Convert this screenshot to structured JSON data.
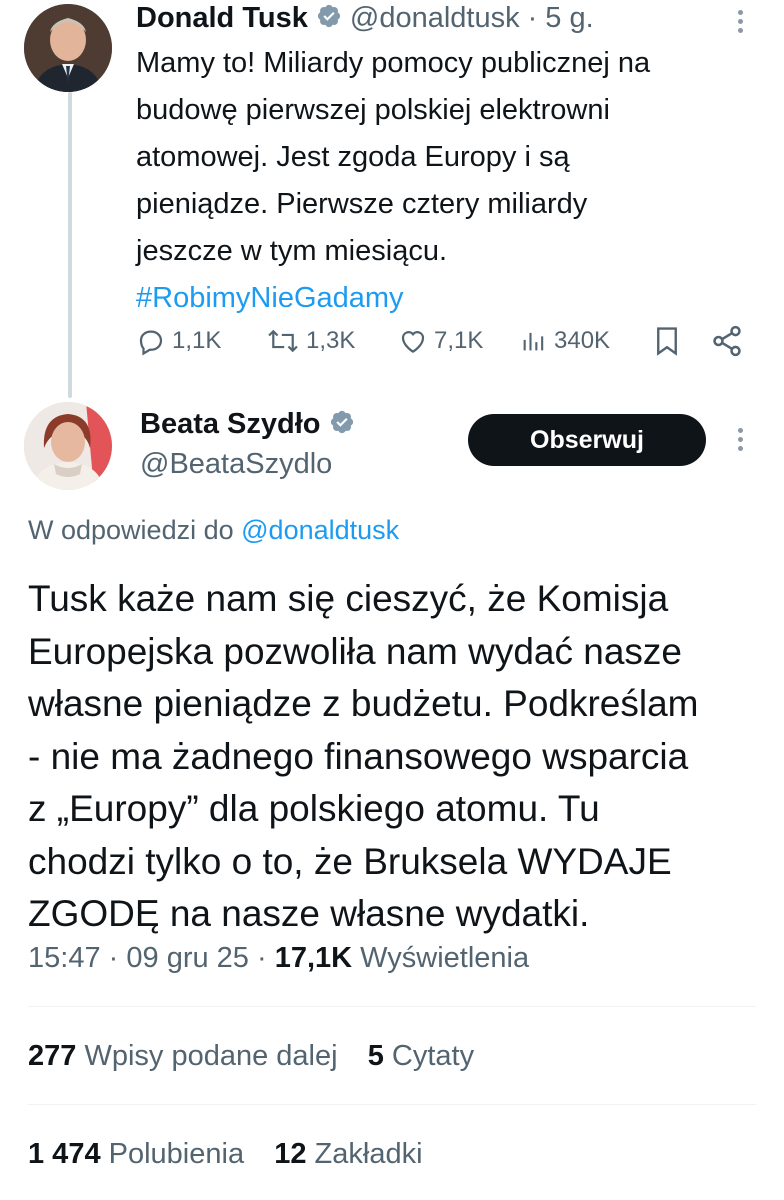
{
  "parent_tweet": {
    "author_name": "Donald Tusk",
    "handle": "@donaldtusk",
    "separator": "·",
    "time": "5 g.",
    "text_lines": [
      "Mamy to! Miliardy pomocy publicznej na",
      "budowę pierwszej polskiej elektrowni",
      "atomowej. Jest zgoda Europy i są",
      "pieniądze. Pierwsze cztery miliardy",
      "jeszcze w tym miesiącu."
    ],
    "hashtag": "#RobimyNieGadamy",
    "actions": {
      "replies": "1,1K",
      "retweets": "1,3K",
      "likes": "7,1K",
      "views": "340K"
    }
  },
  "reply_tweet": {
    "author_name": "Beata Szydło",
    "handle": "@BeataSzydlo",
    "follow_label": "Obserwuj",
    "replying_to_prefix": "W odpowiedzi do",
    "replying_to_handle": "@donaldtusk",
    "text_lines": [
      "Tusk każe nam się cieszyć, że Komisja",
      "Europejska pozwoliła nam wydać nasze",
      "własne pieniądze z budżetu. Podkreślam",
      "- nie ma żadnego finansowego wsparcia",
      "z „Europy” dla polskiego atomu. Tu",
      "chodzi tylko o to, że Bruksela WYDAJE",
      "ZGODĘ na nasze własne wydatki."
    ],
    "meta": {
      "time": "15:47",
      "sep1": "·",
      "date": "09 gru 25",
      "sep2": "·",
      "views_count": "17,1K",
      "views_label": "Wyświetlenia"
    },
    "stats_row1": {
      "retweets_count": "277",
      "retweets_label": "Wpisy podane dalej",
      "quotes_count": "5",
      "quotes_label": "Cytaty"
    },
    "stats_row2": {
      "likes_count": "1 474",
      "likes_label": "Polubienia",
      "bookmarks_count": "12",
      "bookmarks_label": "Zakładki"
    }
  },
  "colors": {
    "accent": "#1d9bf0",
    "text": "#0f1419",
    "muted": "#536471",
    "divider": "#eff3f4",
    "button": "#0f1419"
  }
}
